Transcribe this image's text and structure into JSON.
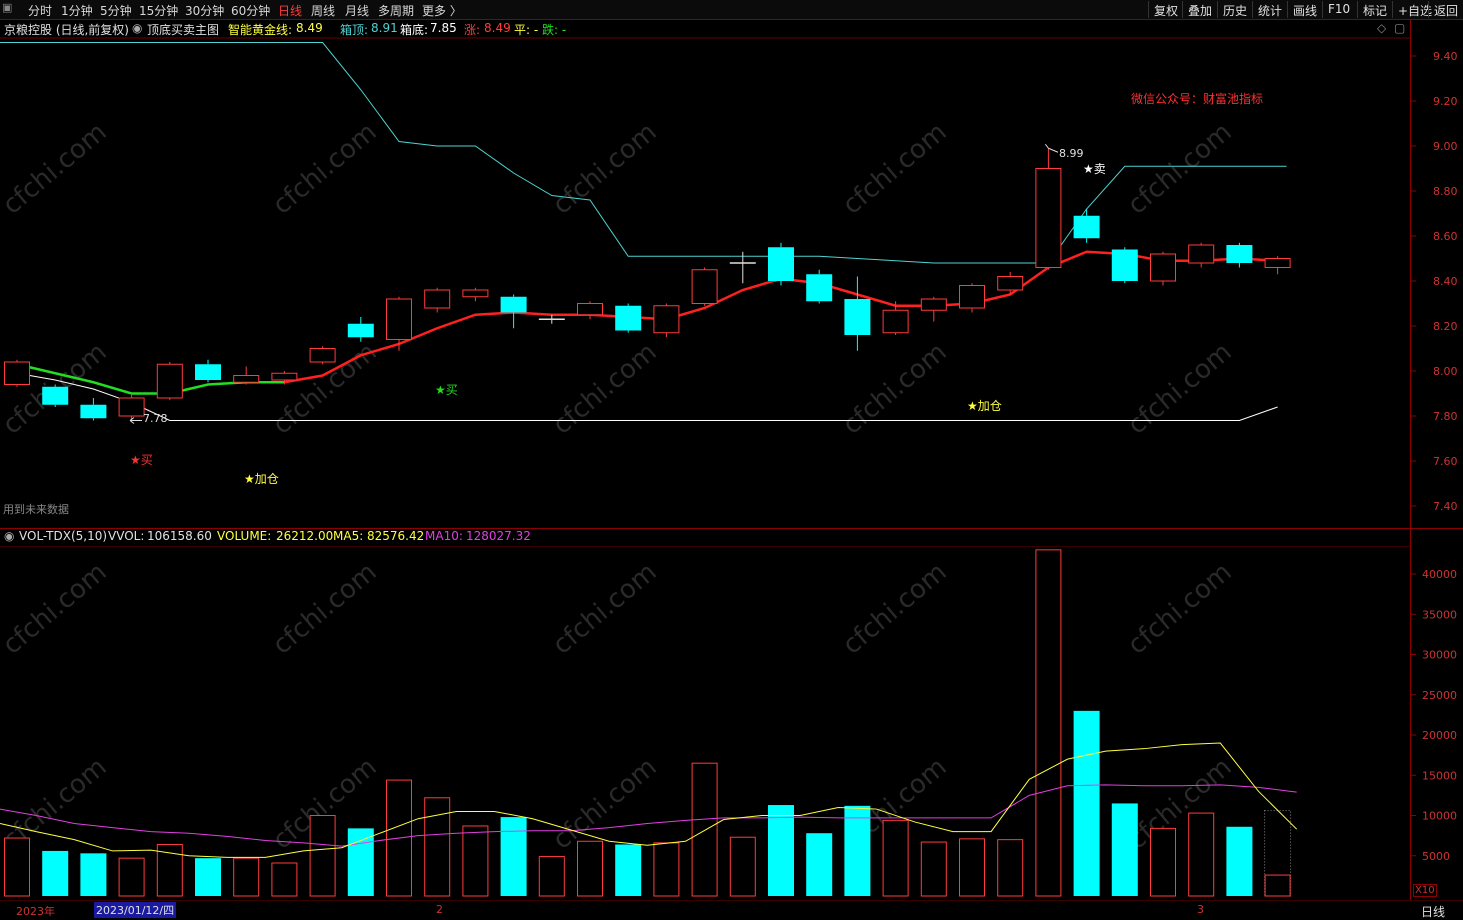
{
  "toolbar": {
    "periods": [
      "分时",
      "1分钟",
      "5分钟",
      "15分钟",
      "30分钟",
      "60分钟",
      "日线",
      "周线",
      "月线",
      "多周期",
      "更多 〉"
    ],
    "active_period": "日线",
    "right_buttons": [
      "复权",
      "叠加",
      "历史",
      "统计",
      "画线",
      "F10",
      "标记",
      "+自选",
      "返回"
    ]
  },
  "info": {
    "stock": "京粮控股 (日线,前复权)",
    "indicator": "顶底买卖主图",
    "gold_label": "智能黄金线:",
    "gold_value": "8.49",
    "top_label": "箱顶:",
    "top_value": "8.91",
    "bottom_label": "箱底:",
    "bottom_value": "7.85",
    "rise_label": "涨:",
    "rise_value": "8.49",
    "flat_label": "平: -",
    "fall_label": "跌: -"
  },
  "watermark": "cfchi.com",
  "main_chart": {
    "ylim": [
      7.3,
      9.5
    ],
    "yticks": [
      "9.40",
      "9.20",
      "9.00",
      "8.80",
      "8.60",
      "8.40",
      "8.20",
      "8.00",
      "7.80",
      "7.60",
      "7.40"
    ],
    "promo_text": "微信公众号：财富池指标",
    "future_data_note": "用到未来数据",
    "high_label": "8.99",
    "low_label": "7.78",
    "signals": {
      "buy_red": "★买",
      "buy_green": "★买",
      "add_1": "★加仓",
      "add_2": "★加仓",
      "sell": "★卖"
    }
  },
  "vol_info": {
    "name": "VOL-TDX(5,10)",
    "vvol_label": "VVOL:",
    "vvol_value": "106158.60",
    "volume_label": "VOLUME:",
    "volume_value": "26212.00",
    "ma5_label": "MA5:",
    "ma5_value": "82576.42",
    "ma10_label": "MA10:",
    "ma10_value": "128027.32"
  },
  "vol_chart": {
    "yticks": [
      "40000",
      "35000",
      "30000",
      "25000",
      "20000",
      "15000",
      "10000",
      "5000"
    ],
    "unit": "X10"
  },
  "bottom": {
    "year": "2023年",
    "cursor_date": "2023/01/12/四",
    "month_2": "2",
    "month_3": "3",
    "period": "日线"
  },
  "colors": {
    "up": "#ff3b3b",
    "down": "#00ffff",
    "box_top_line": "#4fd2d2",
    "box_bottom_line": "#ffffff",
    "gold_line": "#ff2020",
    "gold_line_early": "#22dd22",
    "ma5": "#ffff40",
    "ma10": "#e040e0"
  },
  "chart_data": {
    "type": "candlestick",
    "candles": [
      {
        "o": 7.94,
        "c": 8.04,
        "h": 8.05,
        "l": 7.93,
        "v": 7200
      },
      {
        "o": 7.93,
        "c": 7.85,
        "h": 7.94,
        "l": 7.84,
        "v": 5600
      },
      {
        "o": 7.85,
        "c": 7.79,
        "h": 7.88,
        "l": 7.78,
        "v": 5300
      },
      {
        "o": 7.8,
        "c": 7.88,
        "h": 7.9,
        "l": 7.78,
        "v": 4700
      },
      {
        "o": 7.88,
        "c": 8.03,
        "h": 8.04,
        "l": 7.87,
        "v": 6400
      },
      {
        "o": 8.03,
        "c": 7.96,
        "h": 8.05,
        "l": 7.95,
        "v": 4700
      },
      {
        "o": 7.95,
        "c": 7.98,
        "h": 8.02,
        "l": 7.94,
        "v": 4700
      },
      {
        "o": 7.96,
        "c": 7.99,
        "h": 8.0,
        "l": 7.94,
        "v": 4100
      },
      {
        "o": 8.04,
        "c": 8.1,
        "h": 8.11,
        "l": 8.03,
        "v": 10000
      },
      {
        "o": 8.21,
        "c": 8.15,
        "h": 8.24,
        "l": 8.13,
        "v": 8400
      },
      {
        "o": 8.14,
        "c": 8.32,
        "h": 8.33,
        "l": 8.09,
        "v": 14400
      },
      {
        "o": 8.28,
        "c": 8.36,
        "h": 8.37,
        "l": 8.26,
        "v": 12200
      },
      {
        "o": 8.33,
        "c": 8.36,
        "h": 8.37,
        "l": 8.31,
        "v": 8700
      },
      {
        "o": 8.33,
        "c": 8.26,
        "h": 8.34,
        "l": 8.19,
        "v": 9800
      },
      {
        "o": 8.23,
        "c": 8.23,
        "h": 8.25,
        "l": 8.21,
        "v": 4900
      },
      {
        "o": 8.25,
        "c": 8.3,
        "h": 8.31,
        "l": 8.23,
        "v": 6800
      },
      {
        "o": 8.29,
        "c": 8.18,
        "h": 8.3,
        "l": 8.17,
        "v": 6400
      },
      {
        "o": 8.17,
        "c": 8.29,
        "h": 8.3,
        "l": 8.15,
        "v": 6600
      },
      {
        "o": 8.3,
        "c": 8.45,
        "h": 8.46,
        "l": 8.29,
        "v": 16500
      },
      {
        "o": 8.48,
        "c": 8.48,
        "h": 8.53,
        "l": 8.39,
        "v": 7300
      },
      {
        "o": 8.55,
        "c": 8.4,
        "h": 8.57,
        "l": 8.38,
        "v": 11300
      },
      {
        "o": 8.43,
        "c": 8.31,
        "h": 8.45,
        "l": 8.3,
        "v": 7800
      },
      {
        "o": 8.32,
        "c": 8.16,
        "h": 8.42,
        "l": 8.09,
        "v": 11200
      },
      {
        "o": 8.17,
        "c": 8.27,
        "h": 8.31,
        "l": 8.16,
        "v": 9400
      },
      {
        "o": 8.27,
        "c": 8.32,
        "h": 8.33,
        "l": 8.22,
        "v": 6700
      },
      {
        "o": 8.28,
        "c": 8.38,
        "h": 8.39,
        "l": 8.26,
        "v": 7100
      },
      {
        "o": 8.36,
        "c": 8.42,
        "h": 8.44,
        "l": 8.34,
        "v": 7000
      },
      {
        "o": 8.46,
        "c": 8.9,
        "h": 8.99,
        "l": 8.45,
        "v": 43000
      },
      {
        "o": 8.69,
        "c": 8.59,
        "h": 8.72,
        "l": 8.57,
        "v": 23000
      },
      {
        "o": 8.54,
        "c": 8.4,
        "h": 8.55,
        "l": 8.39,
        "v": 11500
      },
      {
        "o": 8.4,
        "c": 8.52,
        "h": 8.53,
        "l": 8.38,
        "v": 8400
      },
      {
        "o": 8.48,
        "c": 8.56,
        "h": 8.57,
        "l": 8.46,
        "v": 10300
      },
      {
        "o": 8.56,
        "c": 8.48,
        "h": 8.57,
        "l": 8.46,
        "v": 8600
      },
      {
        "o": 8.46,
        "c": 8.5,
        "h": 8.51,
        "l": 8.43,
        "v": 2600
      }
    ],
    "box_top": [
      null,
      null,
      null,
      null,
      null,
      null,
      null,
      9.46,
      9.46,
      9.25,
      9.02,
      9.0,
      9.0,
      8.88,
      8.78,
      8.76,
      8.51,
      8.51,
      8.51,
      8.51,
      8.51,
      8.51,
      8.5,
      8.49,
      8.48,
      8.48,
      8.48,
      8.48,
      8.72,
      8.91,
      8.91,
      8.91,
      8.91,
      8.91
    ],
    "box_bottom": [
      7.99,
      7.96,
      7.92,
      7.86,
      7.78,
      7.78,
      7.78,
      7.78,
      7.78,
      7.78,
      7.78,
      7.78,
      7.78,
      7.78,
      7.78,
      7.78,
      7.78,
      7.78,
      7.78,
      7.78,
      7.78,
      7.78,
      7.78,
      7.78,
      7.78,
      7.78,
      7.78,
      7.78,
      7.78,
      7.78,
      7.78,
      7.78,
      7.78,
      7.84
    ],
    "gold_line": [
      8.03,
      7.99,
      7.95,
      7.9,
      7.9,
      7.94,
      7.95,
      7.95,
      7.98,
      8.07,
      8.12,
      8.19,
      8.25,
      8.26,
      8.25,
      8.25,
      8.24,
      8.23,
      8.28,
      8.36,
      8.41,
      8.39,
      8.34,
      8.29,
      8.29,
      8.3,
      8.34,
      8.46,
      8.53,
      8.52,
      8.49,
      8.49,
      8.5,
      8.49
    ],
    "ma5": [
      9000,
      8000,
      7000,
      5600,
      5700,
      5000,
      4800,
      4800,
      5600,
      6000,
      7800,
      9600,
      10500,
      10500,
      9600,
      8200,
      6800,
      6300,
      6800,
      9500,
      10000,
      10000,
      11000,
      10800,
      9200,
      8000,
      8000,
      14500,
      17000,
      18000,
      18300,
      18800,
      19000,
      13000,
      8300
    ],
    "ma10": [
      10800,
      10000,
      9000,
      8500,
      8000,
      7800,
      7400,
      6900,
      6600,
      6200,
      6900,
      7500,
      7800,
      8000,
      8100,
      8100,
      8500,
      9000,
      9400,
      9700,
      9700,
      9800,
      9700,
      9700,
      9700,
      9700,
      9700,
      12500,
      13700,
      13800,
      13700,
      13700,
      13800,
      13500,
      12900
    ]
  }
}
